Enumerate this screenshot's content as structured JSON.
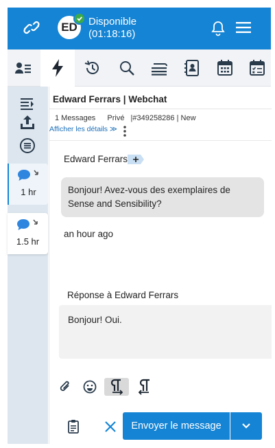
{
  "header": {
    "avatar_initials": "ED",
    "status_line1": "Disponible",
    "status_line2": "(01:18:16)",
    "status_color": "#3daa4a",
    "brand_color": "#1584d4"
  },
  "toolbar": {
    "icons": [
      "contacts-icon",
      "lightning-icon",
      "history-icon",
      "search-icon",
      "queue-icon",
      "address-book-icon",
      "calendar-icon",
      "tasks-calendar-icon"
    ]
  },
  "rail": {
    "icons": [
      "list-indent-icon",
      "upload-icon",
      "menu-circle-icon"
    ],
    "conversations": [
      {
        "icon": "chat-bubble-icon",
        "time": "1 hr"
      },
      {
        "icon": "chat-bubble-icon",
        "time": "1.5 hr"
      }
    ]
  },
  "conversation": {
    "title": "Edward Ferrars  | Webchat",
    "messages_count": "1 Messages",
    "privacy": "Privé",
    "ticket": "|#349258286  |  New",
    "details_link": "Afficher les détails ≫",
    "sender": "Edward Ferrars",
    "message": "Bonjour! Avez-vous des exemplaires de Sense and Sensibility?",
    "message_time": "an hour ago",
    "reply_label": "Réponse à Edward Ferrars",
    "reply_text": "Bonjour! Oui."
  },
  "composer": {
    "send_label": "Envoyer le message"
  }
}
